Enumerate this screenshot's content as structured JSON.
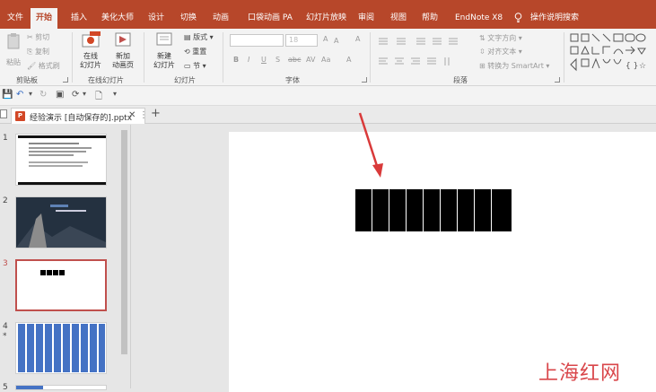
{
  "ribbon_tabs": [
    "文件",
    "开始",
    "插入",
    "美化大师",
    "设计",
    "切换",
    "动画",
    "口袋动画 PA",
    "幻灯片放映",
    "审阅",
    "视图",
    "帮助",
    "EndNote X8"
  ],
  "tell_me": "操作说明搜索",
  "clipboard": {
    "paste": "粘贴",
    "cut": "剪切",
    "copy": "复制",
    "format_painter": "格式刷",
    "label": "剪贴板"
  },
  "online_slides": {
    "online": "在线",
    "online2": "幻灯片",
    "new": "新加",
    "new2": "动画页",
    "hot": "HOT",
    "label": "在线幻灯片"
  },
  "slides_group": {
    "new_slide": "新建",
    "new_slide2": "幻灯片",
    "layout": "版式",
    "reset": "重置",
    "section": "节",
    "label": "幻灯片"
  },
  "font_group": {
    "size": "18",
    "label": "字体",
    "bold": "B",
    "italic": "I",
    "underline": "U",
    "shadow": "S",
    "strike": "abc",
    "spacing": "AV",
    "case": "Aa",
    "grow": "A",
    "shrink": "A",
    "clear": "A"
  },
  "paragraph_group": {
    "text_direction": "文字方向",
    "align_text": "对齐文本",
    "smartart": "转换为 SmartArt",
    "label": "段落"
  },
  "document": {
    "title": "经验演示 [自动保存的].pptx"
  },
  "slides": [
    {
      "number": "1"
    },
    {
      "number": "2"
    },
    {
      "number": "3"
    },
    {
      "number": "4",
      "mark": "*"
    },
    {
      "number": "5"
    }
  ],
  "watermark": "上海红网",
  "colors": {
    "accent": "#b7472a",
    "selection": "#c0504d",
    "blue_bars": "#4472c4"
  }
}
